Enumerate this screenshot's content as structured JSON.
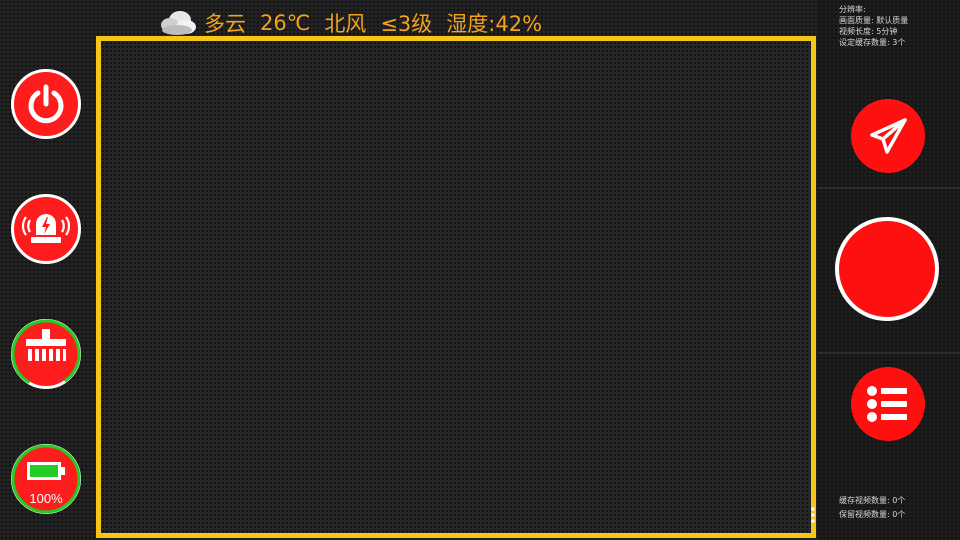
{
  "weather": {
    "condition": "多云",
    "temperature": "26℃",
    "wind_direction": "北风",
    "wind_level": "≤3级",
    "humidity": "湿度:42%"
  },
  "left_controls": {
    "battery_level": "100%"
  },
  "settings_info": {
    "resolution": "分辨率:",
    "quality": "画面质量:  默认质量",
    "video_length": "视频长度:  5分钟",
    "lock_cache_count": "设定缓存数量:  3个"
  },
  "storage_info": {
    "cached_videos": "缓存视频数量:  0个",
    "saved_videos": "保留视频数量:  0个"
  },
  "colors": {
    "accent_red": "#ff1010",
    "frame_yellow": "#f5c518",
    "weather_orange": "#f4a31c",
    "battery_green": "#22cc22"
  }
}
